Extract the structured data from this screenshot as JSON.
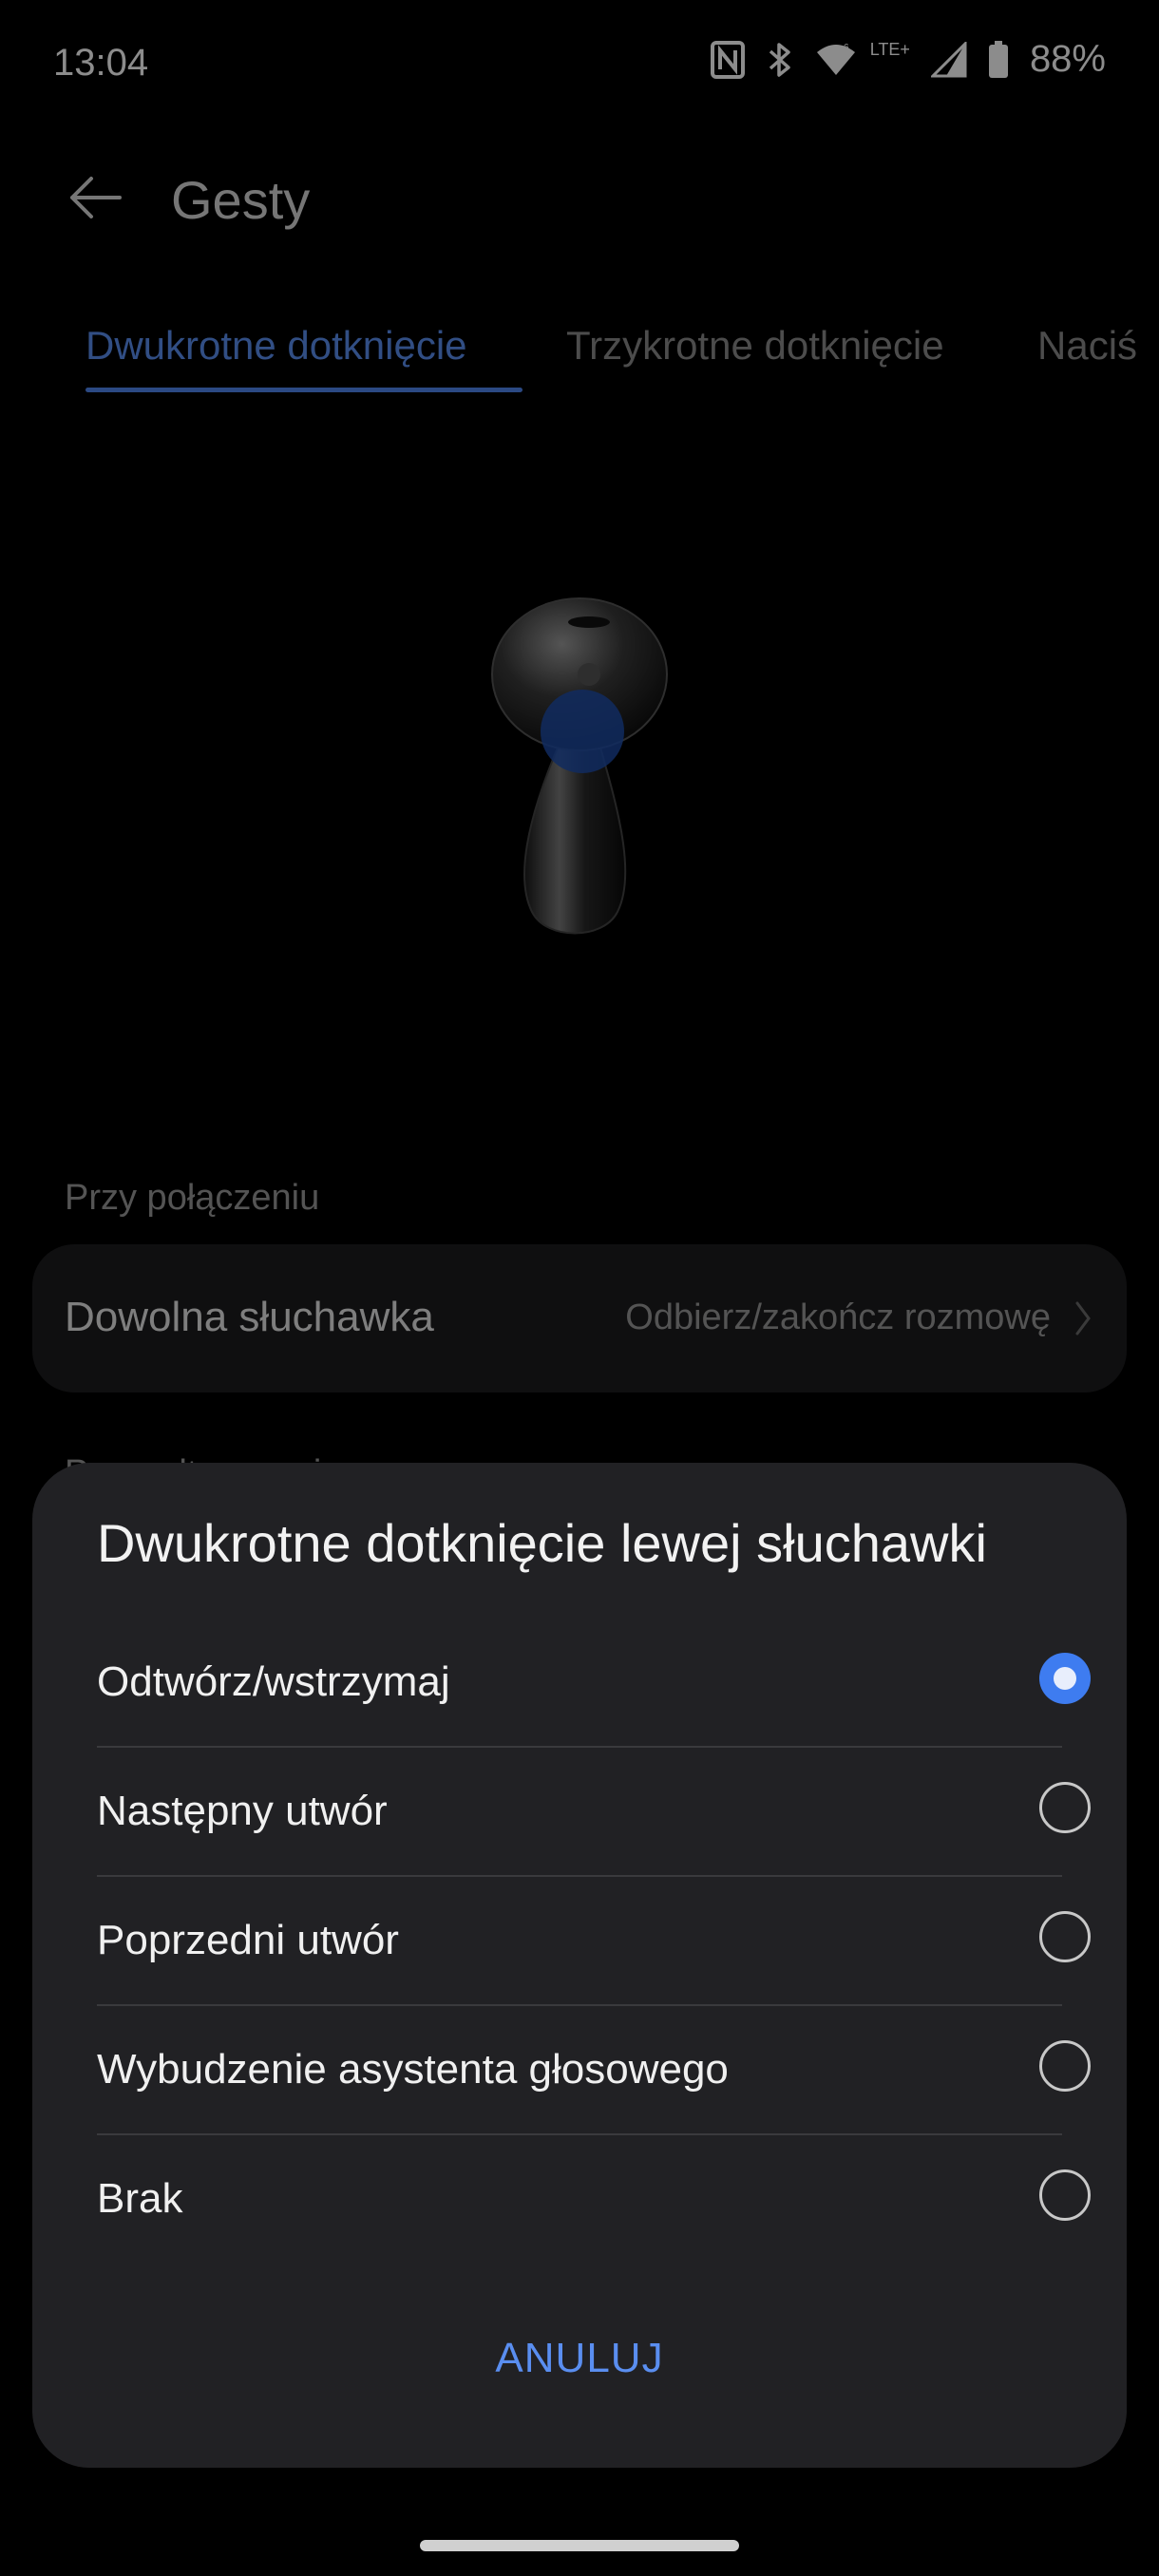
{
  "status_bar": {
    "time": "13:04",
    "network_label": "LTE+",
    "battery": "88%",
    "icons": [
      "nfc-icon",
      "bluetooth-icon",
      "wifi-icon",
      "signal-icon",
      "battery-icon"
    ]
  },
  "app_bar": {
    "title": "Gesty",
    "back_icon": "back-arrow-icon"
  },
  "tabs": [
    {
      "label": "Dwukrotne dotknięcie",
      "active": true
    },
    {
      "label": "Trzykrotne dotknięcie",
      "active": false
    },
    {
      "label": "Naciś",
      "active": false
    }
  ],
  "section": {
    "label": "Przy połączeniu",
    "item": {
      "title": "Dowolna słuchawka",
      "value": "Odbierz/zakończ rozmowę"
    },
    "next_label_peek": "Przy odtwarzaniu"
  },
  "dialog": {
    "title": "Dwukrotne dotknięcie lewej słuchawki",
    "options": [
      {
        "label": "Odtwórz/wstrzymaj",
        "selected": true
      },
      {
        "label": "Następny utwór",
        "selected": false
      },
      {
        "label": "Poprzedni utwór",
        "selected": false
      },
      {
        "label": "Wybudzenie asystenta głosowego",
        "selected": false
      },
      {
        "label": "Brak",
        "selected": false
      }
    ],
    "cancel_label": "ANULUJ"
  },
  "colors": {
    "accent": "#4f86ee",
    "background": "#000000",
    "dialog_bg": "#212124",
    "card_bg": "#1c1c1e"
  }
}
